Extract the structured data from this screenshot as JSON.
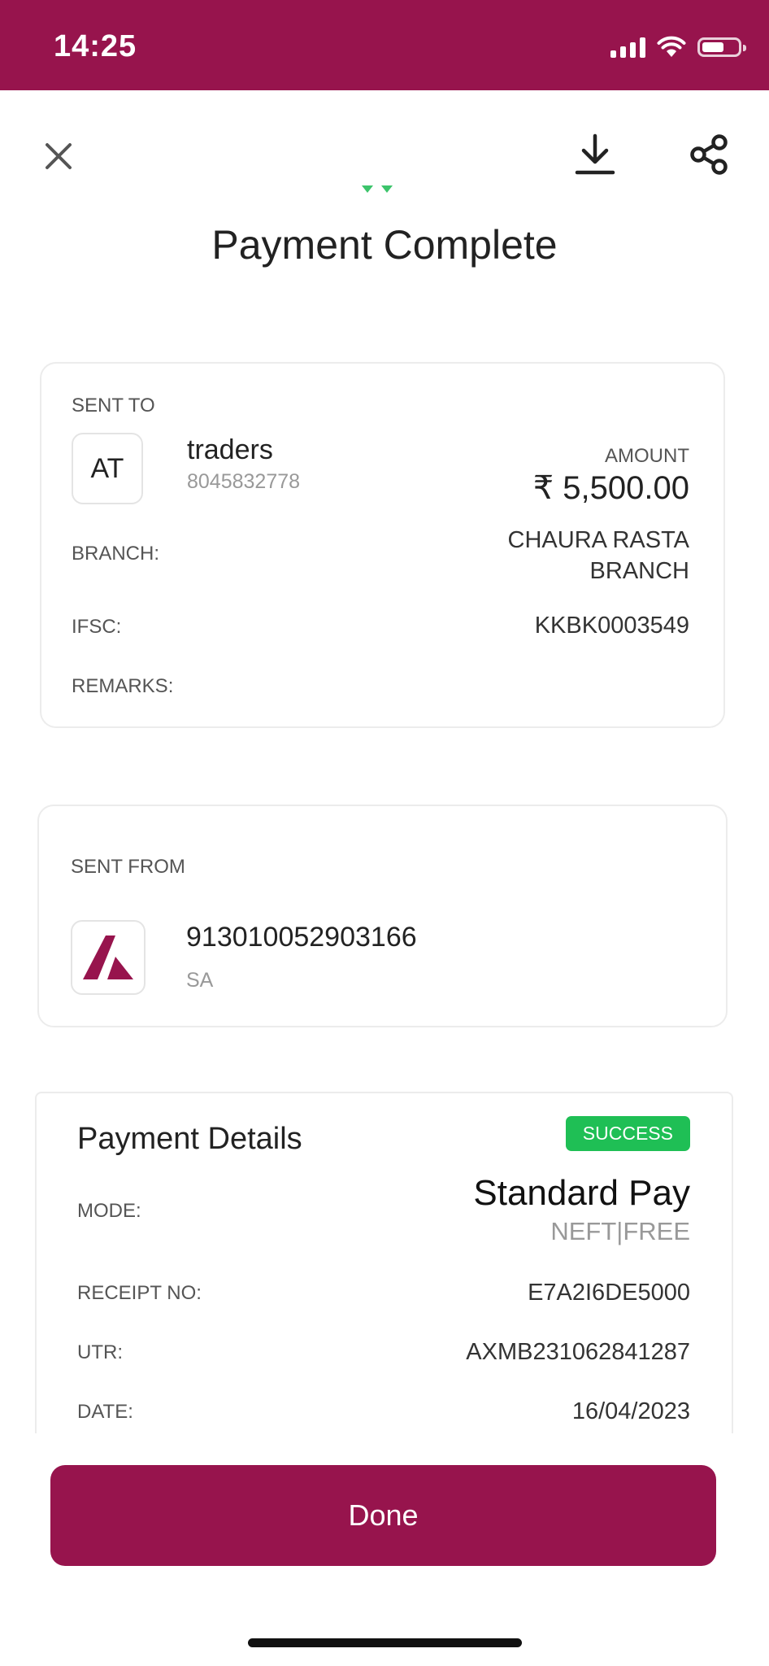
{
  "status_bar": {
    "time": "14:25"
  },
  "header": {
    "close_icon": "close-icon",
    "download_icon": "download-icon",
    "share_icon": "share-icon",
    "title": "Payment Complete"
  },
  "sent_to": {
    "label": "SENT TO",
    "avatar_initials": "AT",
    "name": "traders",
    "account": "8045832778",
    "amount_label": "AMOUNT",
    "amount": "₹ 5,500.00",
    "branch_label": "BRANCH:",
    "branch_line1": "CHAURA RASTA",
    "branch_line2": "BRANCH",
    "ifsc_label": "IFSC:",
    "ifsc": "KKBK0003549",
    "remarks_label": "REMARKS:"
  },
  "sent_from": {
    "label": "SENT FROM",
    "account": "913010052903166",
    "type": "SA",
    "bank_logo": "axis-bank-logo"
  },
  "payment_details": {
    "title": "Payment Details",
    "status": "SUCCESS",
    "mode_label": "MODE:",
    "mode": "Standard Pay",
    "mode_sub": "NEFT|FREE",
    "receipt_label": "RECEIPT NO:",
    "receipt": "E7A2I6DE5000",
    "utr_label": "UTR:",
    "utr": "AXMB231062841287",
    "date_label": "DATE:",
    "date": "16/04/2023"
  },
  "done_label": "Done",
  "colors": {
    "brand": "#97144d",
    "success": "#1fbf55"
  }
}
